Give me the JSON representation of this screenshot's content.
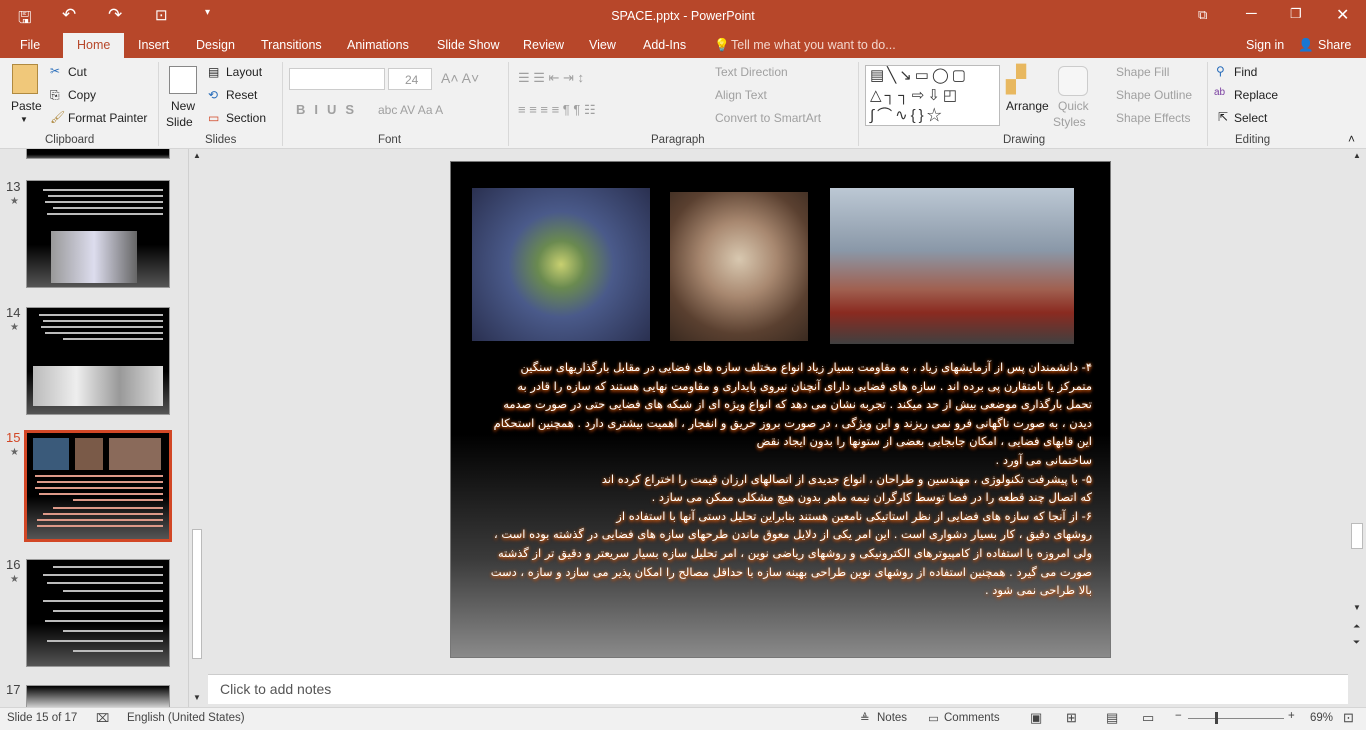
{
  "window": {
    "title": "SPACE.pptx - PowerPoint",
    "accent": "#b7472a"
  },
  "menu": {
    "tabs": [
      "File",
      "Home",
      "Insert",
      "Design",
      "Transitions",
      "Animations",
      "Slide Show",
      "Review",
      "View",
      "Add-Ins"
    ],
    "tell_me": "Tell me what you want to do...",
    "sign_in": "Sign in",
    "share": "Share"
  },
  "ribbon": {
    "clipboard": {
      "paste": "Paste",
      "cut": "Cut",
      "copy": "Copy",
      "format_painter": "Format Painter",
      "label": "Clipboard"
    },
    "slides": {
      "new_slide_1": "New",
      "new_slide_2": "Slide",
      "layout": "Layout",
      "reset": "Reset",
      "section": "Section",
      "label": "Slides"
    },
    "font": {
      "font_name": "",
      "font_size": "24",
      "label": "Font"
    },
    "paragraph": {
      "text_direction": "Text Direction",
      "align_text": "Align Text",
      "convert_smartart": "Convert to SmartArt",
      "label": "Paragraph"
    },
    "drawing": {
      "arrange": "Arrange",
      "quick_styles_1": "Quick",
      "quick_styles_2": "Styles",
      "shape_fill": "Shape Fill",
      "shape_outline": "Shape Outline",
      "shape_effects": "Shape Effects",
      "label": "Drawing"
    },
    "editing": {
      "find": "Find",
      "replace": "Replace",
      "select": "Select",
      "label": "Editing"
    }
  },
  "thumbnails": [
    {
      "num": "13"
    },
    {
      "num": "14"
    },
    {
      "num": "15",
      "selected": true
    },
    {
      "num": "16"
    },
    {
      "num": "17"
    }
  ],
  "slide": {
    "lines": [
      "۴- دانشمندان پس از آزمایشهای زیاد ، به مقاومت بسیار زیاد انواع مختلف سازه های فضایی در مقابل بارگذاریهای سنگین",
      "متمرکز یا نامتقارن پی برده اند . سازه های فضایی دارای آنچنان نیروی پایداری و مقاومت نهایی هستند که سازه را قادر به",
      "تحمل بارگذاری موضعی بیش از حد میکند . تجربه نشان می دهد که انواع ویژه ای از شبکه های فضایی حتی در صورت صدمه",
      "دیدن ، به صورت ناگهانی فرو نمی ریزند و این ویژگی ، در صورت بروز حریق و انفجار ، اهمیت بیشتری دارد . همچنین استحکام",
      "این قابهای فضایی ، امکان جابجایی بعضی از ستونها را بدون ایجاد نقض",
      "ساختمانی می آورد .",
      "۵- با پیشرفت تکنولوژی ، مهندسین و طراحان ، انواع جدیدی از اتصالهای ارزان قیمت را اختراع کرده اند",
      "که اتصال چند قطعه را در فضا توسط کارگران نیمه ماهر بدون هیچ مشکلی ممکن می سازد .",
      "۶- از آنجا که سازه های فضایی از نظر استاتیکی نامعین هستند بنابراین تحلیل دستی آنها با استفاده از",
      "روشهای دقیق ، کار بسیار دشواری است . این امر یکی از دلایل معوق ماندن طرحهای سازه های فضایی در گذشته بوده است ،",
      "ولی امروزه با استفاده از کامپیوترهای الکترونیکی و روشهای ریاضی نوین ، امر تحلیل سازه بسیار سریعتر و دقیق تر از گذشته",
      "صورت می گیرد . همچنین استفاده از روشهای نوین طراحی بهینه سازه با حداقل مصالح را امکان پذیر می سازد و سازه ، دست",
      "بالا طراحی نمی شود ."
    ]
  },
  "notes": {
    "placeholder": "Click to add notes"
  },
  "status": {
    "slide": "Slide 15 of 17",
    "language": "English (United States)",
    "notes": "Notes",
    "comments": "Comments",
    "zoom": "69%"
  }
}
